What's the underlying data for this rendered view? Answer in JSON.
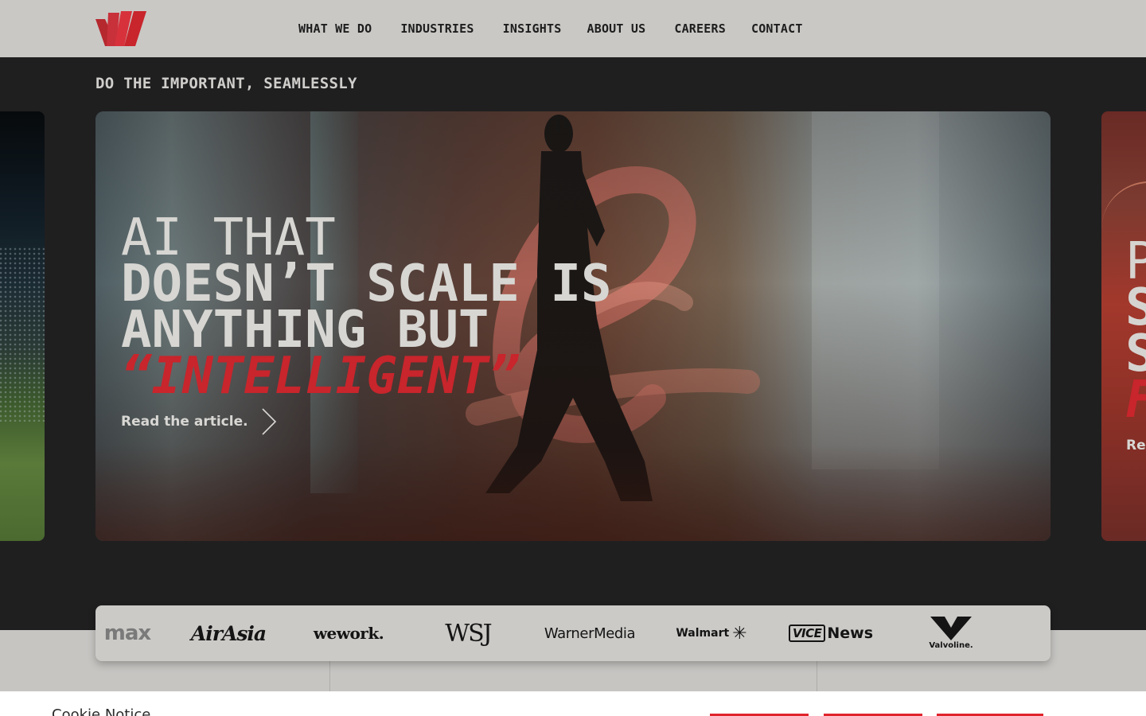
{
  "header": {
    "nav": [
      "WHAT WE DO",
      "INDUSTRIES",
      "INSIGHTS",
      "ABOUT US",
      "CAREERS",
      "CONTACT"
    ]
  },
  "tagline": "DO THE IMPORTANT, SEAMLESSLY",
  "hero": {
    "line1": "AI THAT",
    "line2": "DOESN’T SCALE IS",
    "line3": "ANYTHING BUT",
    "accent": "“INTELLIGENT”",
    "cta": "Read the article."
  },
  "next_card_peek": {
    "line1": "P",
    "line2": "S",
    "line3": "S",
    "accent": "F",
    "cta": "Re"
  },
  "clients": [
    "max",
    "AirAsia",
    "wework.",
    "WSJ",
    "WarnerMedia",
    "Walmart",
    "VICE",
    "News",
    "Valvoline."
  ],
  "cookie": {
    "title": "Cookie Notice"
  },
  "colors": {
    "brand_red": "#c8252c",
    "header_bg": "#c9c8c5",
    "page_bg": "#201f20"
  }
}
